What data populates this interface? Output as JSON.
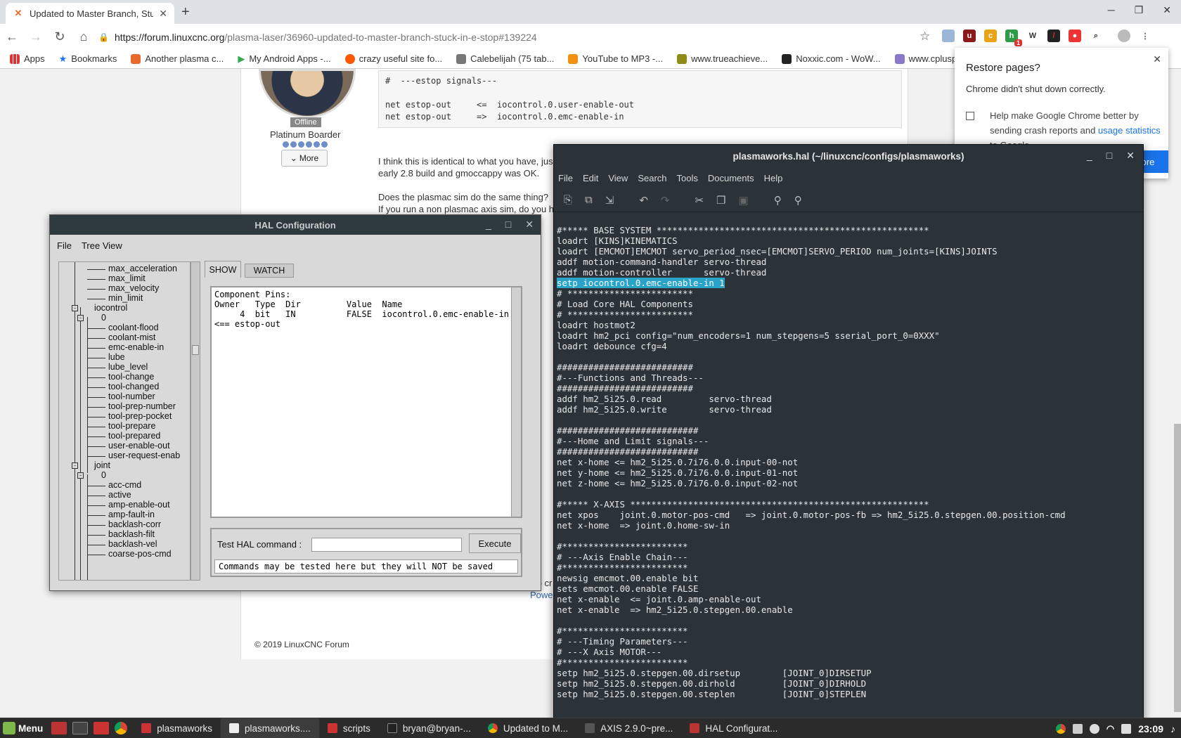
{
  "browser": {
    "tab_title": "Updated to Master Branch, Stu",
    "url_host": "https://forum.linuxcnc.org",
    "url_path": "/plasma-laser/36960-updated-to-master-branch-stuck-in-e-stop#139224",
    "bookmarks": [
      "Apps",
      "Bookmarks",
      "Another plasma c...",
      "My Android Apps -...",
      "crazy useful site fo...",
      "Calebelijah (75 tab...",
      "YouTube to MP3 -...",
      "www.trueachieve...",
      "Noxxic.com - WoW...",
      "www.cplusplu"
    ],
    "extension_badge": "1"
  },
  "forum": {
    "offline_badge": "Offline",
    "rank": "Platinum Boarder",
    "more_button": "More",
    "code_block": "#  ---estop signals---\n\nnet estop-out     <=  iocontrol.0.user-enable-out\nnet estop-out     =>  iocontrol.0.emc-enable-in",
    "para1_line1": "I think this is identical to what you have, jus",
    "para1_line2": "early 2.8 build and gmoccappy was OK.",
    "para2_line1": "Does the plasmac sim do the same thing?",
    "para2_line2": "If you run a non plasmac axis sim, do you h",
    "footer_time": "Time to cr",
    "footer_powered": "Powe",
    "copyright": "© 2019 LinuxCNC Forum"
  },
  "restore_popup": {
    "title": "Restore pages?",
    "subtitle": "Chrome didn't shut down correctly.",
    "help_text_1": "Help make Google Chrome better by sending crash reports and ",
    "help_link": "usage statistics",
    "help_text_2": " to Google",
    "restore_button": "tore"
  },
  "hal": {
    "title": "HAL Configuration",
    "menu": [
      "File",
      "Tree View"
    ],
    "tree": [
      {
        "label": "max_acceleration",
        "level": 3
      },
      {
        "label": "max_limit",
        "level": 3
      },
      {
        "label": "max_velocity",
        "level": 3
      },
      {
        "label": "min_limit",
        "level": 3
      },
      {
        "label": "iocontrol",
        "level": 1,
        "box": "-"
      },
      {
        "label": "0",
        "level": 2,
        "box": "-"
      },
      {
        "label": "coolant-flood",
        "level": 3
      },
      {
        "label": "coolant-mist",
        "level": 3
      },
      {
        "label": "emc-enable-in",
        "level": 3
      },
      {
        "label": "lube",
        "level": 3
      },
      {
        "label": "lube_level",
        "level": 3
      },
      {
        "label": "tool-change",
        "level": 3
      },
      {
        "label": "tool-changed",
        "level": 3
      },
      {
        "label": "tool-number",
        "level": 3
      },
      {
        "label": "tool-prep-number",
        "level": 3
      },
      {
        "label": "tool-prep-pocket",
        "level": 3
      },
      {
        "label": "tool-prepare",
        "level": 3
      },
      {
        "label": "tool-prepared",
        "level": 3
      },
      {
        "label": "user-enable-out",
        "level": 3
      },
      {
        "label": "user-request-enab",
        "level": 3
      },
      {
        "label": "joint",
        "level": 1,
        "box": "-"
      },
      {
        "label": "0",
        "level": 2,
        "box": "-"
      },
      {
        "label": "acc-cmd",
        "level": 3
      },
      {
        "label": "active",
        "level": 3
      },
      {
        "label": "amp-enable-out",
        "level": 3
      },
      {
        "label": "amp-fault-in",
        "level": 3
      },
      {
        "label": "backlash-corr",
        "level": 3
      },
      {
        "label": "backlash-filt",
        "level": 3
      },
      {
        "label": "backlash-vel",
        "level": 3
      },
      {
        "label": "coarse-pos-cmd",
        "level": 3
      }
    ],
    "tab_show": "SHOW",
    "tab_watch": "WATCH",
    "pins_output": "Component Pins:\nOwner   Type  Dir         Value  Name\n     4  bit   IN          FALSE  iocontrol.0.emc-enable-in\n<== estop-out",
    "test_label": "Test HAL command :",
    "test_input_value": "",
    "execute_button": "Execute",
    "test_note": "Commands may be tested here but they will NOT be saved"
  },
  "gedit": {
    "title": "plasmaworks.hal (~/linuxcnc/configs/plasmaworks)",
    "menu": [
      "File",
      "Edit",
      "View",
      "Search",
      "Tools",
      "Documents",
      "Help"
    ],
    "toolbar_icons": [
      "new-document-icon",
      "copy-document-icon",
      "save-as-icon",
      "undo-icon",
      "redo-icon",
      "cut-icon",
      "copy-icon",
      "paste-icon",
      "search-icon",
      "search-replace-icon"
    ],
    "lines_before": "#***** BASE SYSTEM ****************************************************\nloadrt [KINS]KINEMATICS\nloadrt [EMCMOT]EMCMOT servo_period_nsec=[EMCMOT]SERVO_PERIOD num_joints=[KINS]JOINTS\naddf motion-command-handler servo-thread\naddf motion-controller      servo-thread\n",
    "highlighted_line": "setp iocontrol.0.emc-enable-in 1",
    "lines_after": "\n# ************************\n# Load Core HAL Components\n# ************************\nloadrt hostmot2\nloadrt hm2_pci config=\"num_encoders=1 num_stepgens=5 sserial_port_0=0XXX\"\nloadrt debounce cfg=4\n\n##########################\n#---Functions and Threads---\n##########################\naddf hm2_5i25.0.read         servo-thread\naddf hm2_5i25.0.write        servo-thread\n\n###########################\n#---Home and Limit signals---\n###########################\nnet x-home <= hm2_5i25.0.7i76.0.0.input-00-not\nnet y-home <= hm2_5i25.0.7i76.0.0.input-01-not\nnet z-home <= hm2_5i25.0.7i76.0.0.input-02-not\n\n#***** X-AXIS *********************************************************\nnet xpos    joint.0.motor-pos-cmd   => joint.0.motor-pos-fb => hm2_5i25.0.stepgen.00.position-cmd\nnet x-home  => joint.0.home-sw-in\n\n#************************\n# ---Axis Enable Chain---\n#************************\nnewsig emcmot.00.enable bit\nsets emcmot.00.enable FALSE\nnet x-enable  <= joint.0.amp-enable-out\nnet x-enable  => hm2_5i25.0.stepgen.00.enable\n\n#************************\n# ---Timing Parameters---\n# ---X Axis MOTOR---\n#************************\nsetp hm2_5i25.0.stepgen.00.dirsetup        [JOINT_0]DIRSETUP\nsetp hm2_5i25.0.stepgen.00.dirhold         [JOINT_0]DIRHOLD\nsetp hm2_5i25.0.stepgen.00.steplen         [JOINT_0]STEPLEN"
  },
  "taskbar": {
    "menu_label": "Menu",
    "items": [
      "plasmaworks",
      "plasmaworks....",
      "scripts",
      "bryan@bryan-...",
      "Updated to M...",
      "AXIS 2.9.0~pre...",
      "HAL Configurat..."
    ],
    "clock": "23:09"
  }
}
